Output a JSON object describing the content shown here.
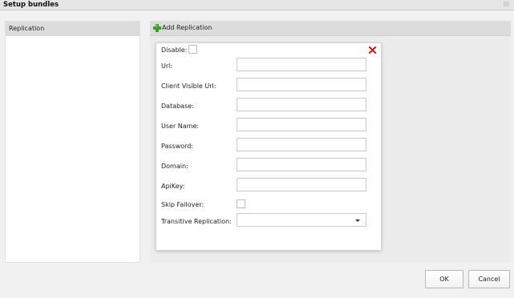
{
  "window": {
    "title": "Setup bundles",
    "close_glyph": "☒"
  },
  "sidebar": {
    "items": [
      {
        "label": "Replication"
      }
    ]
  },
  "main": {
    "add_label": "Add Replication"
  },
  "form": {
    "disable_label": "Disable:",
    "fields": [
      {
        "label": "Url:",
        "value": ""
      },
      {
        "label": "Client Visible Url:",
        "value": ""
      },
      {
        "label": "Database:",
        "value": ""
      },
      {
        "label": "User Name:",
        "value": ""
      },
      {
        "label": "Password:",
        "value": ""
      },
      {
        "label": "Domain:",
        "value": ""
      },
      {
        "label": "ApiKey:",
        "value": ""
      }
    ],
    "skip_failover_label": "Skip Failover:",
    "transitive_label": "Transitive Replication:",
    "transitive_value": ""
  },
  "buttons": {
    "ok": "OK",
    "cancel": "Cancel"
  },
  "colors": {
    "add_icon": "#3c9a2b",
    "remove_icon": "#cc2222"
  }
}
